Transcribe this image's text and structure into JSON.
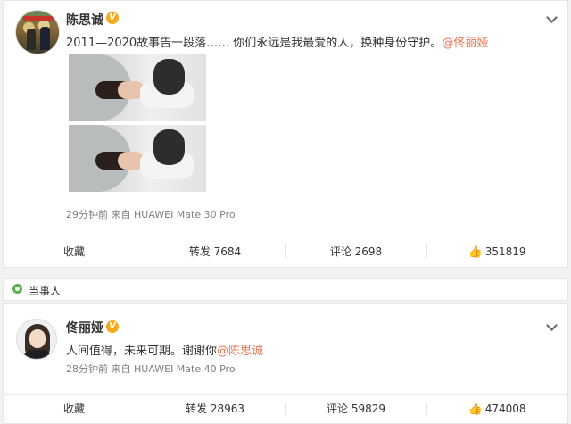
{
  "post1": {
    "author": "陈思诚",
    "text_before": "2011—2020故事告一段落…… 你们永远是我最爱的人，换种身份守护。",
    "mention": "@佟丽娅",
    "meta": "29分钟前  来自 HUAWEI Mate 30 Pro",
    "actions": {
      "collect": "收藏",
      "repost": "转发 7684",
      "comment": "评论 2698",
      "like_count": "351819"
    }
  },
  "tag": {
    "label": "当事人"
  },
  "post2": {
    "author": "佟丽娅",
    "text_before": "人间值得，未来可期。谢谢你",
    "mention": "@陈思诚",
    "meta": "28分钟前  来自 HUAWEI Mate 40 Pro",
    "actions": {
      "collect": "收藏",
      "repost": "转发 28963",
      "comment": "评论 59829",
      "like_count": "474008"
    }
  },
  "icons": {
    "verified": "verified-v-icon",
    "dropdown": "chevron-down-icon",
    "like": "thumbs-up-icon",
    "tag": "person-tag-icon"
  },
  "colors": {
    "mention": "#eb7350",
    "verified": "#f7a81b",
    "tag": "#5ab04a"
  },
  "badge_glyph": "V"
}
